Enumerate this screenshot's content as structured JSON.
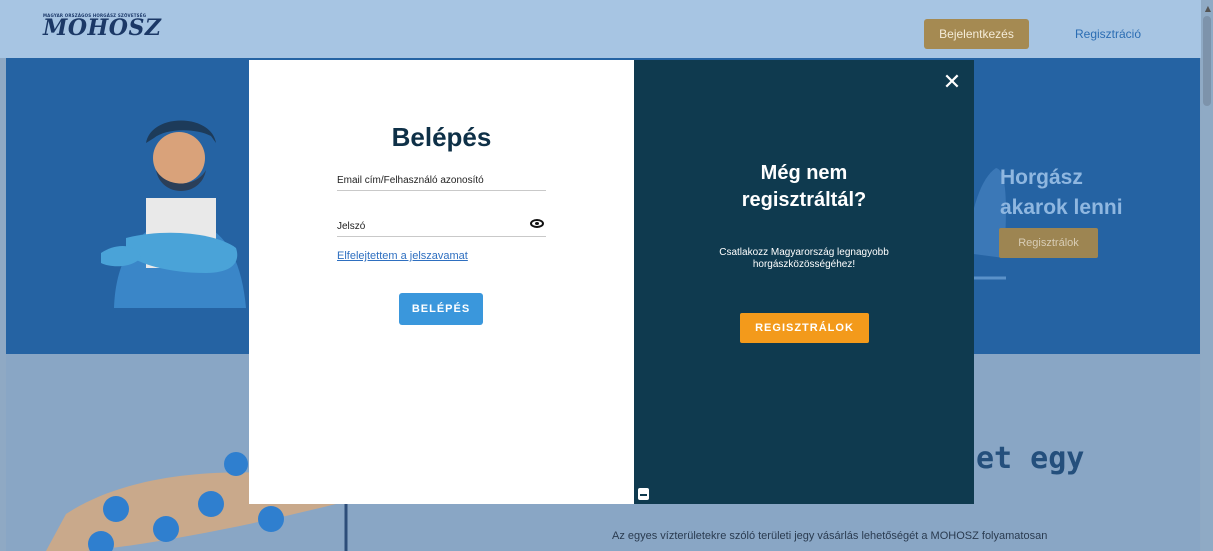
{
  "header": {
    "logo_small": "MAGYAR ORSZÁGOS HORGÁSZ SZÖVETSÉG",
    "logo": "MOHOSZ",
    "login_label": "Bejelentkezés",
    "register_label": "Regisztráció"
  },
  "hero": {
    "title_line1": "Horgász",
    "title_line2": "akarok lenni",
    "button_label": "Regisztrálok"
  },
  "below": {
    "partial_title": "et egy",
    "text": "Az egyes vízterületekre szóló területi jegy vásárlás lehetőségét a MOHOSZ folyamatosan"
  },
  "modal": {
    "login": {
      "title": "Belépés",
      "email_label": "Email cím/Felhasználó azonosító",
      "password_label": "Jelszó",
      "forgot_label": "Elfelejtettem a jelszavamat",
      "submit_label": "BELÉPÉS"
    },
    "register": {
      "title_line1": "Még nem",
      "title_line2": "regisztráltál?",
      "desc_line1": "Csatlakozz Magyarország legnagyobb",
      "desc_line2": "horgászközösségéhez!",
      "button_label": "REGISZTRÁLOK",
      "close_symbol": "✕"
    }
  },
  "colors": {
    "header_bg": "#a7c5e3",
    "hero_bg": "#2563a3",
    "modal_dark": "#0f3a4f",
    "accent_orange": "#f39a1b",
    "accent_blue": "#3a97dc",
    "gold": "#a58a52"
  },
  "icons": [
    "eye-icon",
    "close-icon",
    "chat-icon"
  ]
}
